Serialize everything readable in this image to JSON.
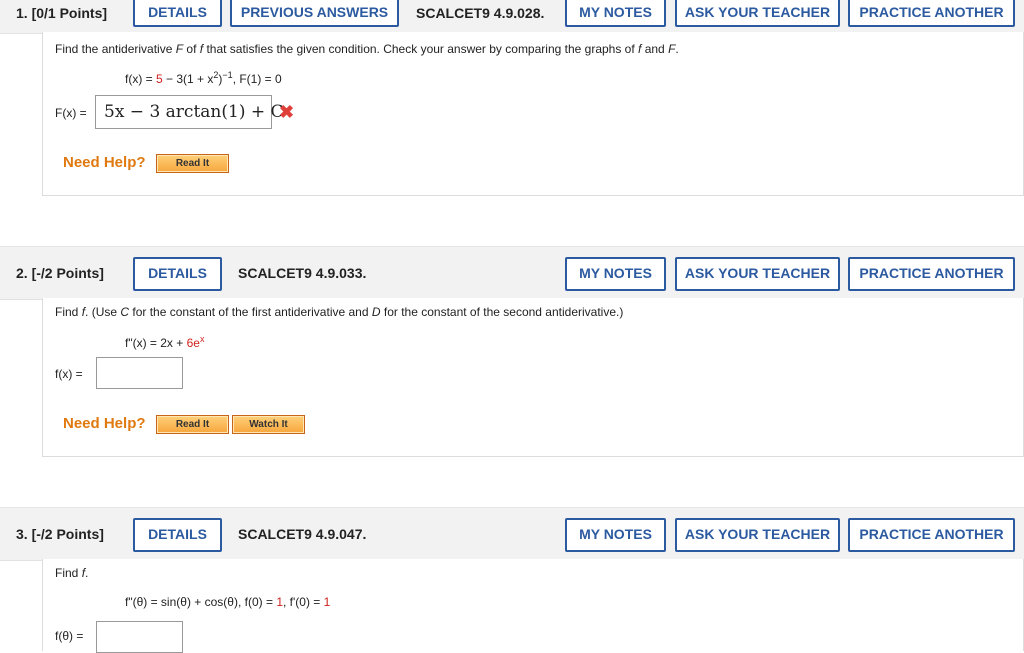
{
  "questions": [
    {
      "number": "1.",
      "points": "[0/1 Points]",
      "details": "DETAILS",
      "previous_answers": "PREVIOUS ANSWERS",
      "code": "SCALCET9 4.9.028.",
      "my_notes": "MY NOTES",
      "ask_teacher": "ASK YOUR TEACHER",
      "practice_another": "PRACTICE ANOTHER",
      "prompt_a": "Find the antiderivative ",
      "prompt_F1": "F",
      "prompt_b": " of ",
      "prompt_f1": "f",
      "prompt_c": " that satisfies the given condition. Check your answer by comparing the graphs of ",
      "prompt_f2": "f",
      "prompt_d": " and ",
      "prompt_F2": "F",
      "prompt_e": ".",
      "func_lhs": "f(x) = ",
      "func_red": "5",
      "func_rhs": " − 3(1 + x",
      "func_sup": "2",
      "func_end": ")",
      "func_sup2": "−1",
      "func_cond": ",    F(1) = 0",
      "answer_label": "F(x) = ",
      "answer_value": "5x − 3 arctan(1) + C",
      "answer_status": "✖",
      "need_help": "Need Help?",
      "read_it": "Read It"
    },
    {
      "number": "2.",
      "points": "[-/2 Points]",
      "details": "DETAILS",
      "code": "SCALCET9 4.9.033.",
      "my_notes": "MY NOTES",
      "ask_teacher": "ASK YOUR TEACHER",
      "practice_another": "PRACTICE ANOTHER",
      "prompt_a": "Find ",
      "prompt_f": "f",
      "prompt_b": ". (Use ",
      "prompt_C": "C",
      "prompt_c": " for the constant of the first antiderivative and ",
      "prompt_D": "D",
      "prompt_d": " for the constant of the second antiderivative.)",
      "func_lhs": "f\"(x) = 2x + ",
      "func_red": "6e",
      "func_sup": "x",
      "answer_label": "f(x) = ",
      "answer_value": "",
      "need_help": "Need Help?",
      "read_it": "Read It",
      "watch_it": "Watch It"
    },
    {
      "number": "3.",
      "points": "[-/2 Points]",
      "details": "DETAILS",
      "code": "SCALCET9 4.9.047.",
      "my_notes": "MY NOTES",
      "ask_teacher": "ASK YOUR TEACHER",
      "practice_another": "PRACTICE ANOTHER",
      "prompt_a": "Find ",
      "prompt_f": "f",
      "prompt_b": ".",
      "func_lhs": "f\"(θ) = sin(θ) + cos(θ),    f(0) = ",
      "func_red1": "1",
      "func_mid": ",    f'(0) = ",
      "func_red2": "1",
      "answer_label": "f(θ) = ",
      "answer_value": ""
    }
  ],
  "colors": {
    "accent": "#2c5aa0",
    "help": "#e07a10",
    "error": "#e0403a",
    "highlight": "#d0221d"
  }
}
